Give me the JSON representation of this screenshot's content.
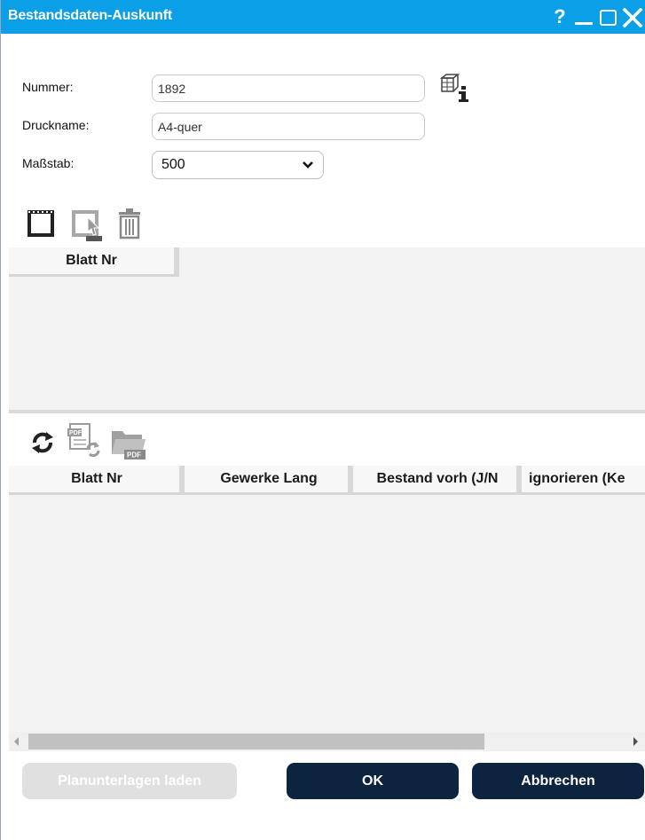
{
  "window": {
    "title": "Bestandsdaten-Auskunft",
    "controls": {
      "help": "?",
      "minimize": "minimize-icon",
      "maximize": "maximize-icon",
      "close": "close-icon"
    },
    "accent_color": "#0a9fe6",
    "button_color": "#0c2440"
  },
  "form": {
    "nummer_label": "Nummer:",
    "nummer_value": "1892",
    "druckname_label": "Druckname:",
    "druckname_value": "A4-quer",
    "massstab_label": "Maßstab:",
    "massstab_value": "500"
  },
  "toolbar1": {
    "icons": [
      "frame-icon",
      "frame-select-icon",
      "trash-icon"
    ]
  },
  "grid1": {
    "columns": [
      "Blatt Nr"
    ],
    "rows": []
  },
  "toolbar2": {
    "icons": [
      "refresh-icon",
      "pdf-refresh-icon",
      "pdf-folder-icon"
    ]
  },
  "grid2": {
    "columns": [
      "Blatt Nr",
      "Gewerke Lang",
      "Bestand vorh (J/N",
      "ignorieren (Ke"
    ],
    "rows": []
  },
  "buttons": {
    "load": "Planunterlagen laden",
    "ok": "OK",
    "cancel": "Abbrechen"
  }
}
